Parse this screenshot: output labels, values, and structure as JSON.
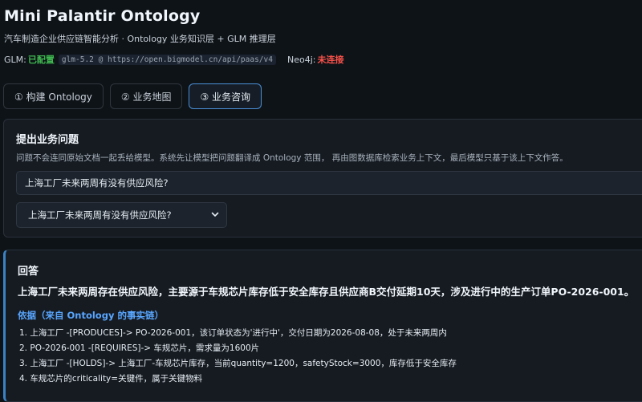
{
  "header": {
    "title": "Mini Palantir Ontology",
    "subtitle": "汽车制造企业供应链智能分析 · Ontology 业务知识层 + GLM 推理层",
    "glm_label": "GLM:",
    "glm_status": "已配置",
    "glm_endpoint": "glm-5.2 @ https://open.bigmodel.cn/api/paas/v4",
    "neo4j_label": "Neo4j:",
    "neo4j_status": "未连接"
  },
  "tabs": [
    {
      "label": "① 构建 Ontology",
      "active": false
    },
    {
      "label": "② 业务地图",
      "active": false
    },
    {
      "label": "③ 业务咨询",
      "active": true
    }
  ],
  "question_panel": {
    "title": "提出业务问题",
    "description": "问题不会连同原始文档一起丢给模型。系统先让模型把问题翻译成 Ontology 范围， 再由图数据库检索业务上下文，最后模型只基于该上下文作答。",
    "input_value": "上海工厂未来两周有没有供应风险?",
    "select_value": "上海工厂未来两周有没有供应风险?"
  },
  "answer": {
    "title": "回答",
    "main": "上海工厂未来两周存在供应风险，主要源于车规芯片库存低于安全库存且供应商B交付延期10天，涉及进行中的生产订单PO-2026-001。",
    "basis_title": "依据（来自 Ontology 的事实链）",
    "facts": [
      "1. 上海工厂 -[PRODUCES]-> PO-2026-001，该订单状态为'进行中'，交付日期为2026-08-08，处于未来两周内",
      "2. PO-2026-001 -[REQUIRES]-> 车规芯片，需求量为1600片",
      "3. 上海工厂 -[HOLDS]-> 上海工厂-车规芯片库存，当前quantity=1200，safetyStock=3000，库存低于安全库存",
      "4. 车规芯片的criticality=关键件，属于关键物料"
    ]
  },
  "colors": {
    "background": "#0e1318",
    "ok": "#3fb950",
    "error": "#f85149",
    "accent": "#58a6ff"
  }
}
